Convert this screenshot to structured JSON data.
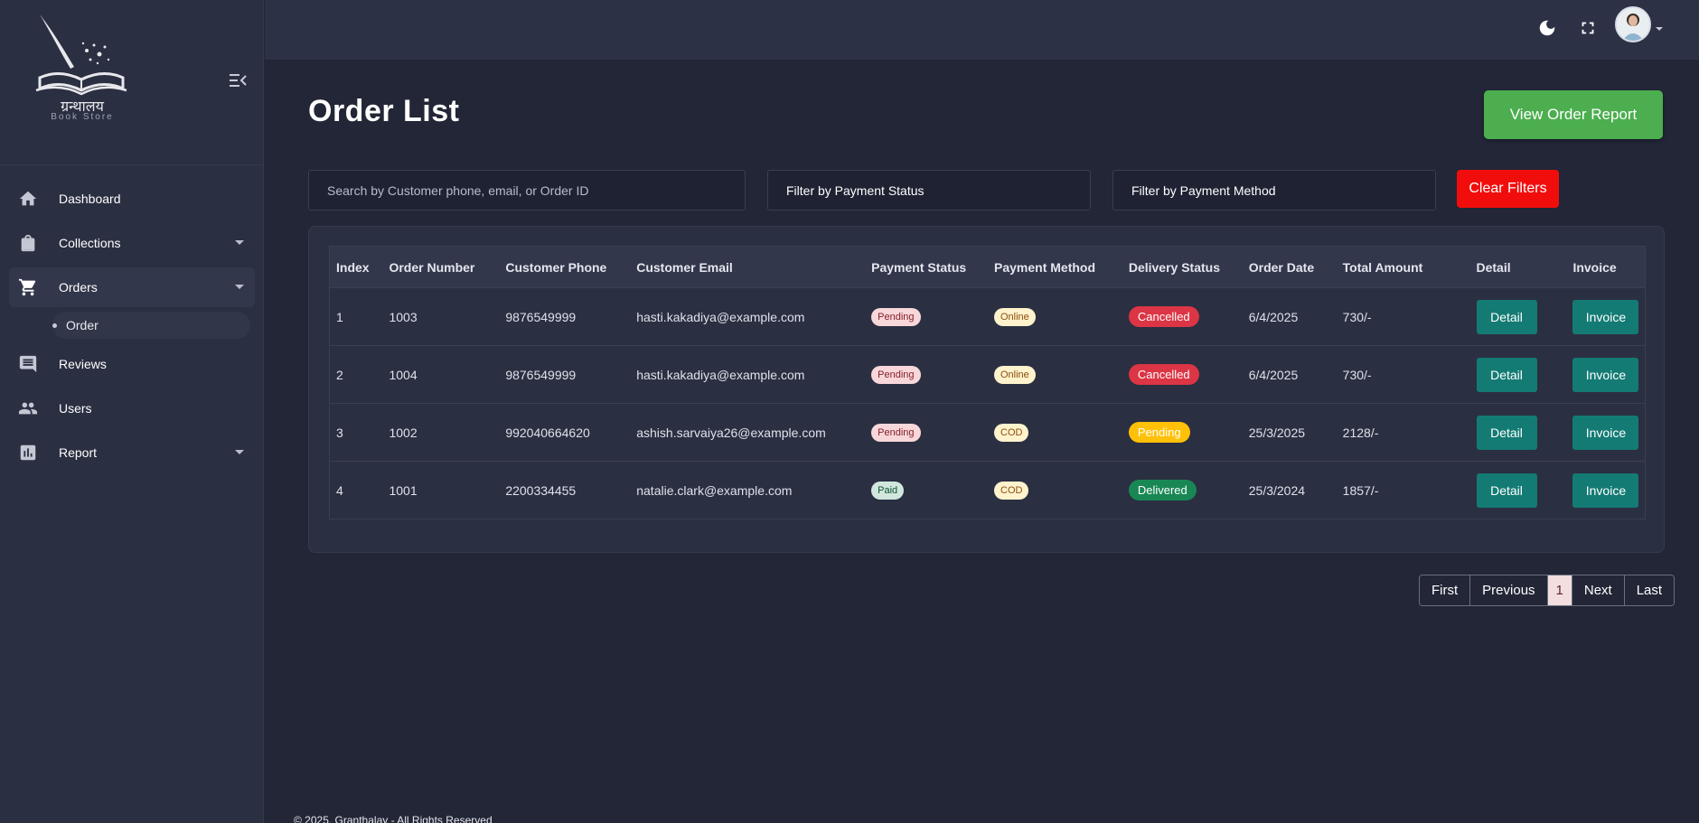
{
  "brand": {
    "title": "ग्रन्थालय",
    "subtitle": "Book Store"
  },
  "sidebar": {
    "items": [
      {
        "label": "Dashboard",
        "icon": "home-icon"
      },
      {
        "label": "Collections",
        "icon": "shopping-bag-icon"
      },
      {
        "label": "Orders",
        "icon": "cart-icon"
      },
      {
        "label": "Order",
        "icon": "dot-icon"
      },
      {
        "label": "Reviews",
        "icon": "comment-icon"
      },
      {
        "label": "Users",
        "icon": "users-icon"
      },
      {
        "label": "Report",
        "icon": "chart-icon"
      }
    ]
  },
  "topbar": {
    "icons": [
      "theme-toggle-icon",
      "fullscreen-icon",
      "avatar"
    ]
  },
  "main": {
    "title": "Order List",
    "report_button": "View Order Report",
    "search_placeholder": "Search by Customer phone, email, or Order ID",
    "filter_payment_status": "Filter by Payment Status",
    "filter_payment_method": "Filter by Payment Method",
    "clear_filters": "Clear Filters"
  },
  "table": {
    "headers": [
      "Index",
      "Order Number",
      "Customer Phone",
      "Customer Email",
      "Payment Status",
      "Payment Method",
      "Delivery Status",
      "Order Date",
      "Total Amount",
      "Detail",
      "Invoice"
    ],
    "rows": [
      {
        "index": "1",
        "order": "1003",
        "phone": "9876549999",
        "email": "hasti.kakadiya@example.com",
        "payment_status": "Pending",
        "payment_method": "Online",
        "delivery": "Cancelled",
        "date": "6/4/2025",
        "total": "730/-",
        "detail": "Detail",
        "invoice": "Invoice"
      },
      {
        "index": "2",
        "order": "1004",
        "phone": "9876549999",
        "email": "hasti.kakadiya@example.com",
        "payment_status": "Pending",
        "payment_method": "Online",
        "delivery": "Cancelled",
        "date": "6/4/2025",
        "total": "730/-",
        "detail": "Detail",
        "invoice": "Invoice"
      },
      {
        "index": "3",
        "order": "1002",
        "phone": "992040664620",
        "email": "ashish.sarvaiya26@example.com",
        "payment_status": "Pending",
        "payment_method": "COD",
        "delivery": "Pending",
        "date": "25/3/2025",
        "total": "2128/-",
        "detail": "Detail",
        "invoice": "Invoice"
      },
      {
        "index": "4",
        "order": "1001",
        "phone": "2200334455",
        "email": "natalie.clark@example.com",
        "payment_status": "Paid",
        "payment_method": "COD",
        "delivery": "Delivered",
        "date": "25/3/2024",
        "total": "1857/-",
        "detail": "Detail",
        "invoice": "Invoice"
      }
    ]
  },
  "pagination": {
    "first": "First",
    "previous": "Previous",
    "current": "1",
    "next": "Next",
    "last": "Last"
  },
  "footer": {
    "text": "© 2025, Granthalay - All Rights Reserved"
  },
  "colors": {
    "background": "#222636",
    "sidebar": "#2b2f42",
    "success": "#4cae4f",
    "danger": "#f20d0d",
    "teal": "#137b74"
  }
}
